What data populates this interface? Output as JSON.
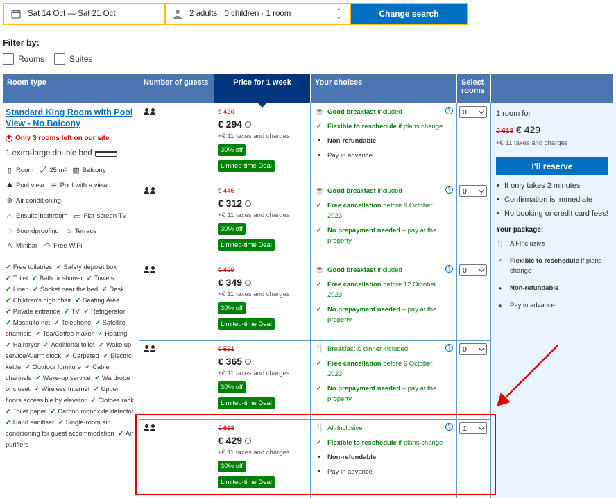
{
  "search": {
    "dates": "Sat 14 Oct — Sat 21 Oct",
    "guests": "2 adults · 0 children · 1 room",
    "button": "Change search"
  },
  "filter": {
    "title": "Filter by:",
    "options": [
      "Rooms",
      "Suites"
    ]
  },
  "headers": {
    "room_type": "Room type",
    "guests": "Number of guests",
    "price": "Price for 1 week",
    "choices": "Your choices",
    "select": "Select rooms"
  },
  "room": {
    "title": "Standard King Room with Pool View - No Balcony",
    "urgency": "Only 3 rooms left on our site",
    "bed": "1 extra-large double bed",
    "facilities": [
      [
        "Room",
        "25 m²",
        "Balcony"
      ],
      [
        "Pool view",
        "Pool with a view"
      ],
      [
        "Air conditioning"
      ],
      [
        "Ensuite bathroom",
        "Flat-screen TV"
      ],
      [
        "Soundproofing",
        "Terrace"
      ],
      [
        "Minibar",
        "Free WiFi"
      ]
    ],
    "amenities": [
      "Free toiletries",
      "Safety deposit box",
      "Toilet",
      "Bath or shower",
      "Towels",
      "Linen",
      "Socket near the bed",
      "Desk",
      "Children's high chair",
      "Seating Area",
      "Private entrance",
      "TV",
      "Refrigerator",
      "Mosquito net",
      "Telephone",
      "Satellite channels",
      "Tea/Coffee maker",
      "Heating",
      "Hairdryer",
      "Additional toilet",
      "Wake up service/Alarm clock",
      "Carpeted",
      "Electric kettle",
      "Outdoor furniture",
      "Cable channels",
      "Wake-up service",
      "Wardrobe or closet",
      "Wireless Internet",
      "Upper floors accessible by elevator",
      "Clothes rack",
      "Toilet paper",
      "Carbon monoxide detector",
      "Hand sanitiser",
      "Single-room air conditioning for guest accommodation",
      "Air purifiers"
    ]
  },
  "offers": [
    {
      "old_price": "€ 420",
      "price": "€ 294",
      "tax": "+€ 11 taxes and charges",
      "discount": "30% off",
      "deal": "Limited-time Deal",
      "selected": "0",
      "choices": [
        {
          "icon": "coffee-icon",
          "bold": "Good breakfast",
          "rest": " included",
          "style": "green"
        },
        {
          "icon": "check-icon",
          "bold": "Flexible to reschedule",
          "rest": " if plans change",
          "style": "green"
        },
        {
          "icon": "bullet",
          "bold": "Non-refundable",
          "rest": "",
          "style": "plain"
        },
        {
          "icon": "bullet",
          "bold": "",
          "rest": "Pay in advance",
          "style": "plain"
        }
      ]
    },
    {
      "old_price": "€ 446",
      "price": "€ 312",
      "tax": "+€ 11 taxes and charges",
      "discount": "30% off",
      "deal": "Limited-time Deal",
      "selected": "0",
      "choices": [
        {
          "icon": "coffee-icon",
          "bold": "Good breakfast",
          "rest": " included",
          "style": "green"
        },
        {
          "icon": "check-icon",
          "bold": "Free cancellation",
          "rest": " before 9 October 2023",
          "style": "green"
        },
        {
          "icon": "check-icon",
          "bold": "No prepayment needed",
          "rest": " – pay at the property",
          "style": "green"
        }
      ]
    },
    {
      "old_price": "€ 499",
      "price": "€ 349",
      "tax": "+€ 11 taxes and charges",
      "discount": "30% off",
      "deal": "Limited-time Deal",
      "selected": "0",
      "choices": [
        {
          "icon": "coffee-icon",
          "bold": "Good breakfast",
          "rest": " included",
          "style": "green"
        },
        {
          "icon": "check-icon",
          "bold": "Free cancellation",
          "rest": " before 12 October 2023",
          "style": "green"
        },
        {
          "icon": "check-icon",
          "bold": "No prepayment needed",
          "rest": " – pay at the property",
          "style": "green"
        }
      ]
    },
    {
      "old_price": "€ 521",
      "price": "€ 365",
      "tax": "+€ 11 taxes and charges",
      "discount": "30% off",
      "deal": "Limited-time Deal",
      "selected": "0",
      "choices": [
        {
          "icon": "cutlery-icon",
          "bold": "",
          "rest": "Breakfast & dinner included",
          "style": "green"
        },
        {
          "icon": "check-icon",
          "bold": "Free cancellation",
          "rest": " before 9 October 2023",
          "style": "green"
        },
        {
          "icon": "check-icon",
          "bold": "No prepayment needed",
          "rest": " – pay at the property",
          "style": "green"
        }
      ]
    },
    {
      "old_price": "€ 613",
      "price": "€ 429",
      "tax": "+€ 11 taxes and charges",
      "discount": "30% off",
      "deal": "Limited-time Deal",
      "selected": "1",
      "choices": [
        {
          "icon": "cutlery-icon",
          "bold": "",
          "rest": "All-Inclusive",
          "style": "green"
        },
        {
          "icon": "check-icon",
          "bold": "Flexible to reschedule",
          "rest": " if plans change",
          "style": "green"
        },
        {
          "icon": "bullet",
          "bold": "Non-refundable",
          "rest": "",
          "style": "plain"
        },
        {
          "icon": "bullet",
          "bold": "",
          "rest": "Pay in advance",
          "style": "plain"
        }
      ]
    }
  ],
  "summary": {
    "rooms_for": "1 room for",
    "old_price": "€ 613",
    "price": "€ 429",
    "tax": "+€ 11 taxes and charges",
    "reserve": "I'll reserve",
    "bullets": [
      "It only takes 2 minutes",
      "Confirmation is immediate",
      "No booking or credit card fees!"
    ],
    "package_title": "Your package:",
    "package": [
      {
        "icon": "cutlery-icon",
        "bold": "",
        "rest": "All-Inclusive"
      },
      {
        "icon": "check-icon",
        "bold": "Flexible to reschedule",
        "rest": " if plans change"
      },
      {
        "icon": "bullet",
        "bold": "Non-refundable",
        "rest": ""
      },
      {
        "icon": "bullet",
        "bold": "",
        "rest": "Pay in advance"
      }
    ]
  },
  "colors": {
    "header": "#4c76b2",
    "header_active": "#003580",
    "primary": "#0071c2",
    "green": "#008009",
    "red": "#cc0000",
    "highlight": "#e00000"
  }
}
